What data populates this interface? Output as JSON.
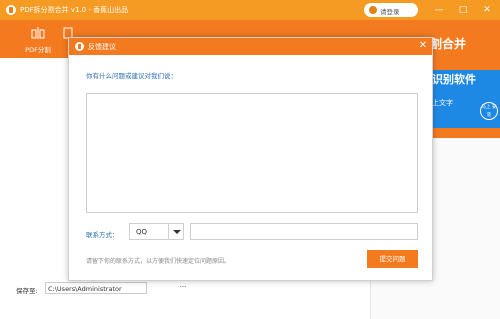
{
  "app": {
    "title": "PDF拆分割合并 v1.0 - 香蕉山出品",
    "login_label": "请登录",
    "minimize_label": "—",
    "maximize_label": "□",
    "close_label": "✕"
  },
  "toolbar": {
    "items": [
      {
        "label": "PDF分割",
        "icon": "split-icon"
      },
      {
        "label": "",
        "icon": "merge-icon"
      }
    ]
  },
  "promo": {
    "heading": "割合并",
    "title": "识别软件",
    "subtitle": "上文字",
    "badge": "马上\n安装",
    "colors": {
      "orange": "#f47a20",
      "blue": "#1e88e5"
    }
  },
  "save": {
    "label": "保存至:",
    "path": "C:\\Users\\Administrator",
    "browse_label": "···"
  },
  "dialog": {
    "title": "反馈建议",
    "close_label": "✕",
    "prompt": "你有什么问题或建议对我们说：",
    "textarea_value": "",
    "contact_label": "联系方式：",
    "contact_type": "QQ",
    "contact_value": "",
    "hint": "请留下你的联系方式，以方便我们快速定位问题原因。",
    "submit_label": "提交问题"
  },
  "colors": {
    "accent": "#f47a20",
    "link_blue": "#2e6fb6"
  }
}
